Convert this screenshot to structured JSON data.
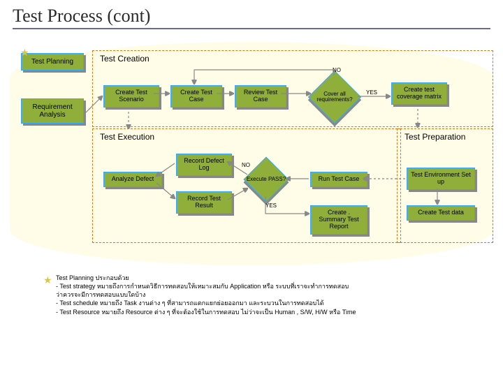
{
  "title": "Test Process (cont)",
  "sidebar": {
    "planning": "Test Planning",
    "req_analysis": "Requirement Analysis"
  },
  "panels": {
    "creation": "Test Creation",
    "execution": "Test Execution",
    "preparation": "Test Preparation"
  },
  "boxes": {
    "create_scenario": "Create Test Scenario",
    "create_case": "Create Test Case",
    "review_case": "Review Test Case",
    "cover_all": "Cover all requirements?",
    "coverage_matrix": "Create test coverage matrix",
    "analyze_defect": "Analyze Defect",
    "record_defect": "Record Defect Log",
    "record_result": "Record Test Result",
    "execute_pass": "Execute PASS?",
    "run_test": "Run Test Case",
    "summary_report": "Create . Summary Test Report",
    "env_setup": "Test Environment Set up",
    "create_data": "Create Test data"
  },
  "labels": {
    "no": "NO",
    "yes": "YES"
  },
  "footer": {
    "l1": "Test Planning ประกอบด้วย",
    "l2": "- Test strategy  หมายถึงการกำหนดวิธีการทดสอบให้เหมาะสมกับ           Application หรือ   ระบบที่เราจะทำการทดสอบ",
    "l3": "ว่าควรจะมีการทดสอบแบบใดบ้าง",
    "l4": "- Test schedule หมายถึง   Task งานต่าง ๆ  ที่สามารถแตกแยกย่อยออกมา        และระบวนในการทดสอบได้",
    "l5": "- Test Resource หมายถึง   Resource ต่าง ๆ  ที่จะต้องใช้ในการทดสอบ        ไม่ว่าจะเป็น        Human , S/W, H/W หรือ  Time"
  }
}
